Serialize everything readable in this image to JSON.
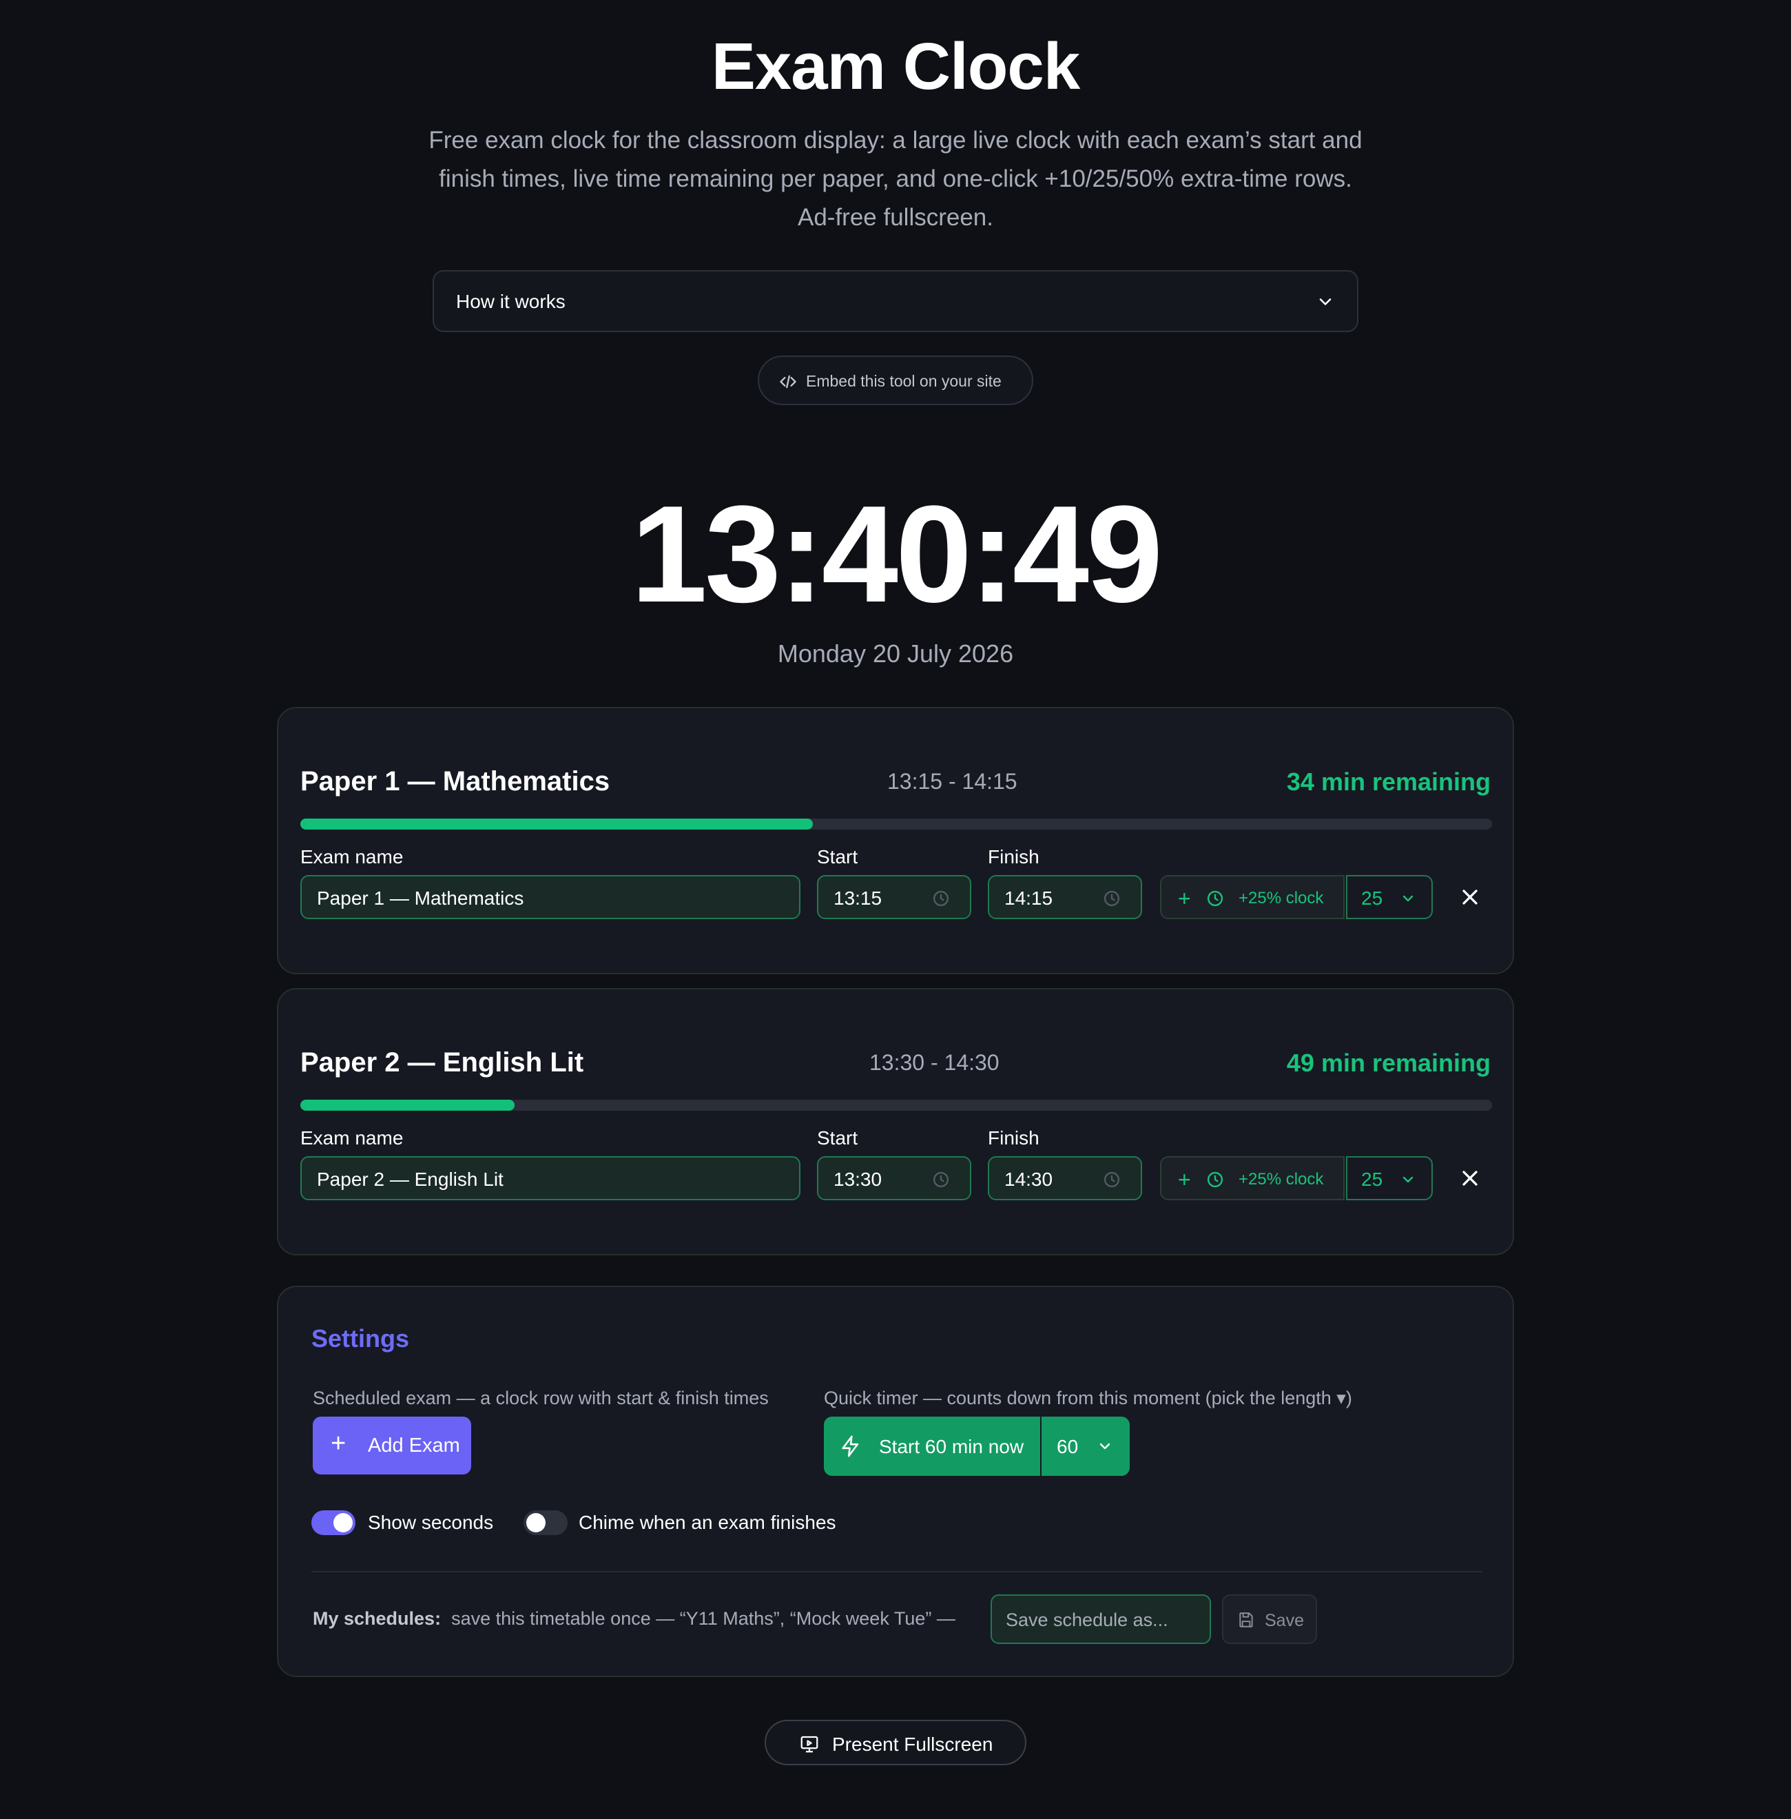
{
  "header": {
    "title": "Exam Clock",
    "subtitle": "Free exam clock for the classroom display: a large live clock with each exam’s start and finish times, live time remaining per paper, and one-click +10/25/50% extra-time rows. Ad-free fullscreen."
  },
  "how_it_works": {
    "label": "How it works",
    "icon": "chevron-down-icon"
  },
  "embed": {
    "label": "Embed this tool on your site",
    "icon": "code-icon"
  },
  "clock": {
    "time": "13:40:49",
    "date": "Monday 20 July 2026"
  },
  "exams": [
    {
      "name": "Paper 1 — Mathematics",
      "times": "13:15 - 14:15",
      "remaining": "34 min remaining",
      "progress": 0.43,
      "fields": {
        "name_label": "Exam name",
        "name_value": "Paper 1 — Mathematics",
        "start_label": "Start",
        "start_value": "13:15",
        "finish_label": "Finish",
        "finish_value": "14:15"
      },
      "extra_time": {
        "label": "+25% clock",
        "percent": "25"
      }
    },
    {
      "name": "Paper 2 — English Lit",
      "times": "13:30 - 14:30",
      "remaining": "49 min remaining",
      "progress": 0.18,
      "fields": {
        "name_label": "Exam name",
        "name_value": "Paper 2 — English Lit",
        "start_label": "Start",
        "start_value": "13:30",
        "finish_label": "Finish",
        "finish_value": "14:30"
      },
      "extra_time": {
        "label": "+25% clock",
        "percent": "25"
      }
    }
  ],
  "settings": {
    "heading": "Settings",
    "scheduled_label": "Scheduled exam — a clock row with start & finish times",
    "add_exam": "Add Exam",
    "quick_label": "Quick timer — counts down from this moment (pick the length ▾)",
    "start_now": "Start 60 min now",
    "length": "60",
    "show_seconds": {
      "label": "Show seconds",
      "on": true
    },
    "chime": {
      "label": "Chime when an exam finishes",
      "on": false
    },
    "my_schedules_label": "My schedules:",
    "my_schedules_text": "save this timetable once — “Y11 Maths”, “Mock week Tue” —",
    "save_placeholder": "Save schedule as...",
    "save_button": "Save"
  },
  "present": {
    "label": "Present Fullscreen",
    "icon": "monitor-icon"
  },
  "colors": {
    "accent_green": "#19c37d",
    "accent_purple": "#6b63f5",
    "background": "#0e1015"
  }
}
